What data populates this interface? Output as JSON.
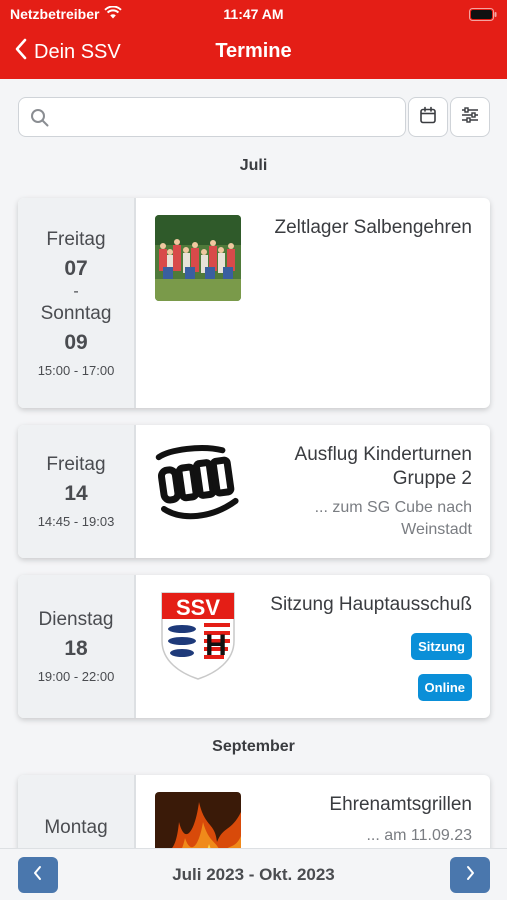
{
  "status_bar": {
    "carrier": "Netzbetreiber",
    "time": "11:47 AM"
  },
  "nav": {
    "back_label": "Dein SSV",
    "title": "Termine"
  },
  "search": {
    "placeholder": ""
  },
  "months": [
    "Juli",
    "September"
  ],
  "events": [
    {
      "day_start": "Freitag",
      "date_start": "07",
      "separator": "-",
      "day_end": "Sonntag",
      "date_end": "09",
      "time": "15:00 - 17:00",
      "title": "Zeltlager Salbengehren",
      "image": "group-photo"
    },
    {
      "day_start": "Freitag",
      "date_start": "14",
      "time": "14:45 - 19:03",
      "title_line1": "Ausflug Kinderturnen",
      "title_line2": "Gruppe 2",
      "sub_line1": "... zum SG Cube nach",
      "sub_line2": "Weinstadt",
      "image": "sg-cube-logo"
    },
    {
      "day_start": "Dienstag",
      "date_start": "18",
      "time": "19:00 - 22:00",
      "title": "Sitzung Hauptausschuß",
      "badges": [
        "Sitzung",
        "Online"
      ],
      "image": "ssv-logo"
    },
    {
      "day_start": "Montag",
      "title": "Ehrenamtsgrillen",
      "subtitle": "... am 11.09.23",
      "image": "fire-photo"
    }
  ],
  "ssv_logo_text": "SSV",
  "ssv_logo_letter": "H",
  "pager": {
    "period": "Juli 2023 - Okt. 2023"
  },
  "colors": {
    "header": "#e41e16",
    "badge": "#0a8fd8",
    "pager_button": "#4a77ad"
  }
}
